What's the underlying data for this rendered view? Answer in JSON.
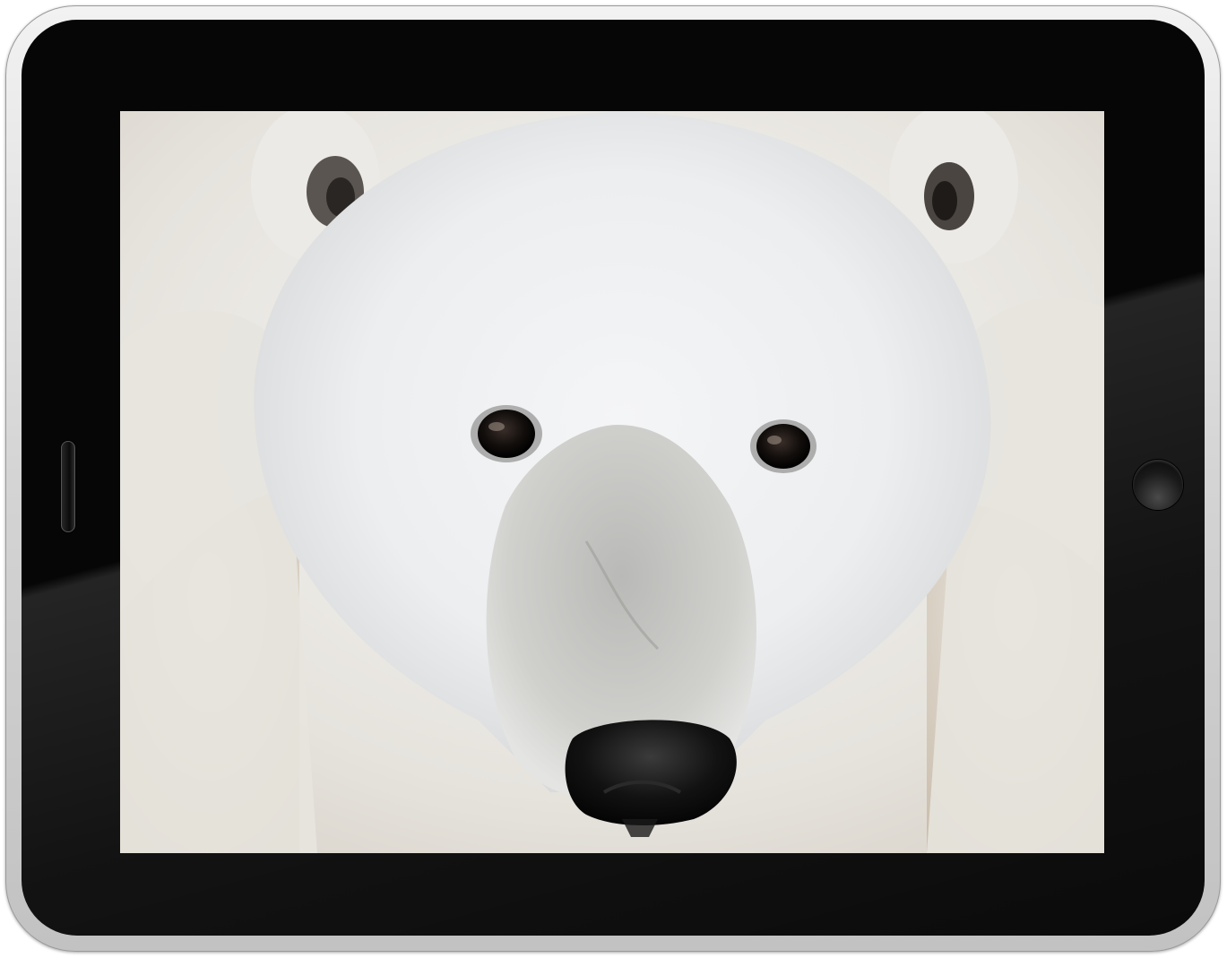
{
  "device": {
    "type": "tablet",
    "bezel_color": "#060606",
    "frame_color": "#d4d4d4"
  },
  "screen": {
    "content": "photo",
    "subject_icon": "polar-bear-photo"
  },
  "controls": {
    "home_button_icon": "home-button-icon",
    "speaker_icon": "speaker-grille-icon"
  }
}
